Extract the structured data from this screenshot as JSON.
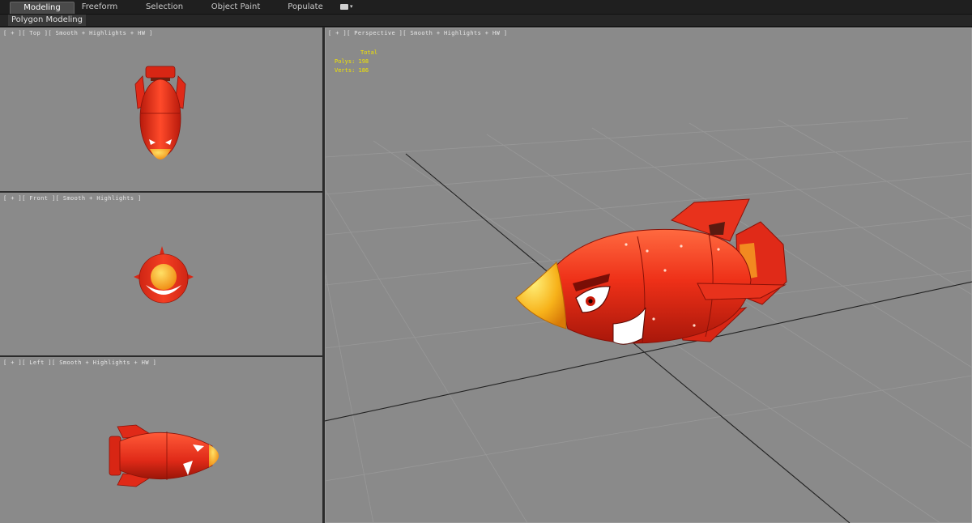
{
  "ribbon": {
    "tabs": [
      {
        "label": "Modeling",
        "active": true
      },
      {
        "label": "Freeform",
        "active": false
      },
      {
        "label": "Selection",
        "active": false
      },
      {
        "label": "Object Paint",
        "active": false
      },
      {
        "label": "Populate",
        "active": false
      }
    ],
    "panel_title": "Polygon Modeling",
    "toggle_icon": "display-options-icon"
  },
  "viewports": {
    "top": {
      "label": "[ + ][ Top ][ Smooth + Highlights + HW ]"
    },
    "front": {
      "label": "[ + ][ Front ][ Smooth + Highlights ]"
    },
    "left": {
      "label": "[ + ][ Left ][ Smooth + Highlights + HW ]"
    },
    "perspective": {
      "label": "[ + ][ Perspective ][ Smooth + Highlights + HW ]",
      "stats": {
        "total_label": "Total",
        "polys": "Polys: 198",
        "verts": "Verts: 186"
      }
    }
  },
  "colors": {
    "viewport_bg": "#8a8a8a",
    "body_red": "#e8321c",
    "nose_yellow": "#f7b21a",
    "stats_yellow": "#f2e400"
  }
}
